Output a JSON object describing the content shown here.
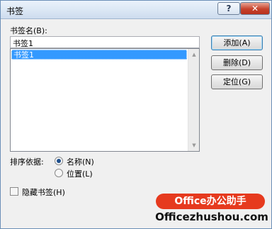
{
  "window": {
    "title": "书签"
  },
  "titlebar": {
    "help": "?",
    "close": "✕"
  },
  "bookmark_name": {
    "label": "书签名(B):",
    "value": "书签1"
  },
  "list": {
    "items": [
      "书签1"
    ],
    "scroll_up": "▲",
    "scroll_down": "▼"
  },
  "buttons": {
    "add": "添加(A)",
    "delete": "删除(D)",
    "goto": "定位(G)"
  },
  "sort": {
    "label": "排序依据:",
    "options": [
      "名称(N)",
      "位置(L)"
    ],
    "selected": "名称(N)"
  },
  "hidden": {
    "label": "隐藏书签(H)",
    "checked": false
  },
  "watermark": {
    "brand": "Office办公助手",
    "url": "Officezhushou.com"
  }
}
